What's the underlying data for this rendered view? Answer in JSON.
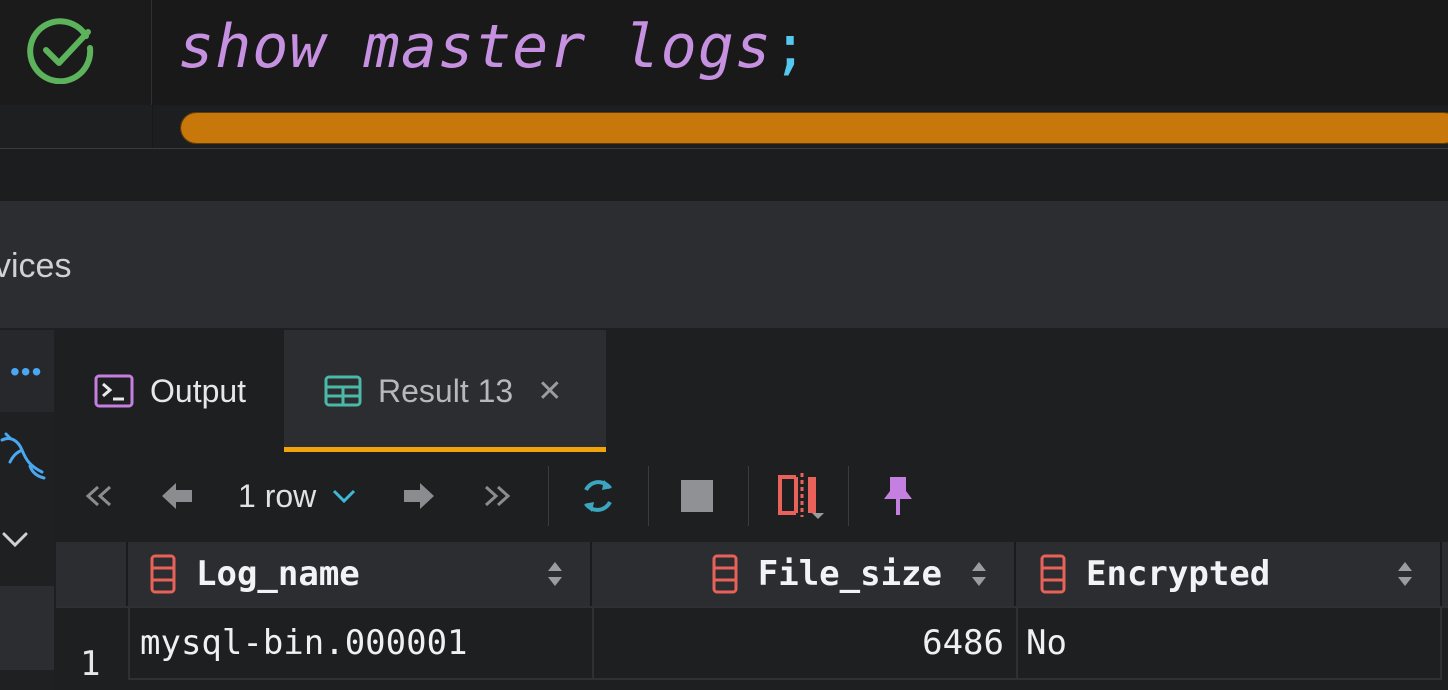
{
  "editor": {
    "keyword_text": "show master logs",
    "semicolon": ";",
    "progress_percent": 100,
    "status_icon": "check-circle-icon",
    "accent_color": "#c8780a"
  },
  "services": {
    "title": "vices"
  },
  "side": {
    "more_icon": "•••",
    "db_icon": "mysql-dolphin-icon"
  },
  "tabs": [
    {
      "label": "Output",
      "icon": "terminal-icon"
    },
    {
      "label": "Result 13",
      "icon": "table-icon",
      "close": "✕",
      "active": true
    }
  ],
  "toolbar": {
    "rows_label": "1 row",
    "first_icon": "«",
    "last_icon": "»"
  },
  "grid": {
    "columns": [
      "Log_name",
      "File_size",
      "Encrypted"
    ],
    "rows": [
      {
        "num": "1",
        "Log_name": "mysql-bin.000001",
        "File_size": "6486",
        "Encrypted": "No"
      }
    ]
  }
}
